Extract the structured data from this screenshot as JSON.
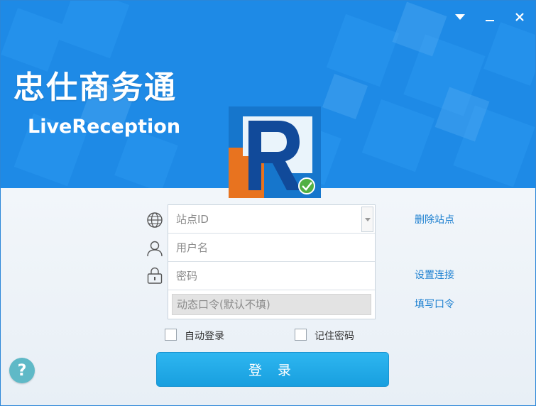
{
  "app": {
    "title_cn": "忠仕商务通",
    "title_en": "LiveReception"
  },
  "form": {
    "site_id_placeholder": "站点ID",
    "username_placeholder": "用户名",
    "password_placeholder": "密码",
    "token_placeholder": "动态口令(默认不填)"
  },
  "links": {
    "delete_site": "删除站点",
    "settings_connection": "设置连接",
    "enter_token": "填写口令"
  },
  "options": {
    "auto_login": "自动登录",
    "remember_password": "记住密码"
  },
  "login_label": "登 录",
  "help_label": "?",
  "icons": {
    "globe": "globe-icon",
    "user": "user-icon",
    "lock": "lock-icon",
    "menu": "dropdown-triangle-icon",
    "minimize": "minimize-icon",
    "close": "close-icon"
  },
  "colors": {
    "banner": "#1e8ae6",
    "login_button": "#1ea6e6",
    "link": "#1b7fd0",
    "help": "#5fb9c7"
  }
}
